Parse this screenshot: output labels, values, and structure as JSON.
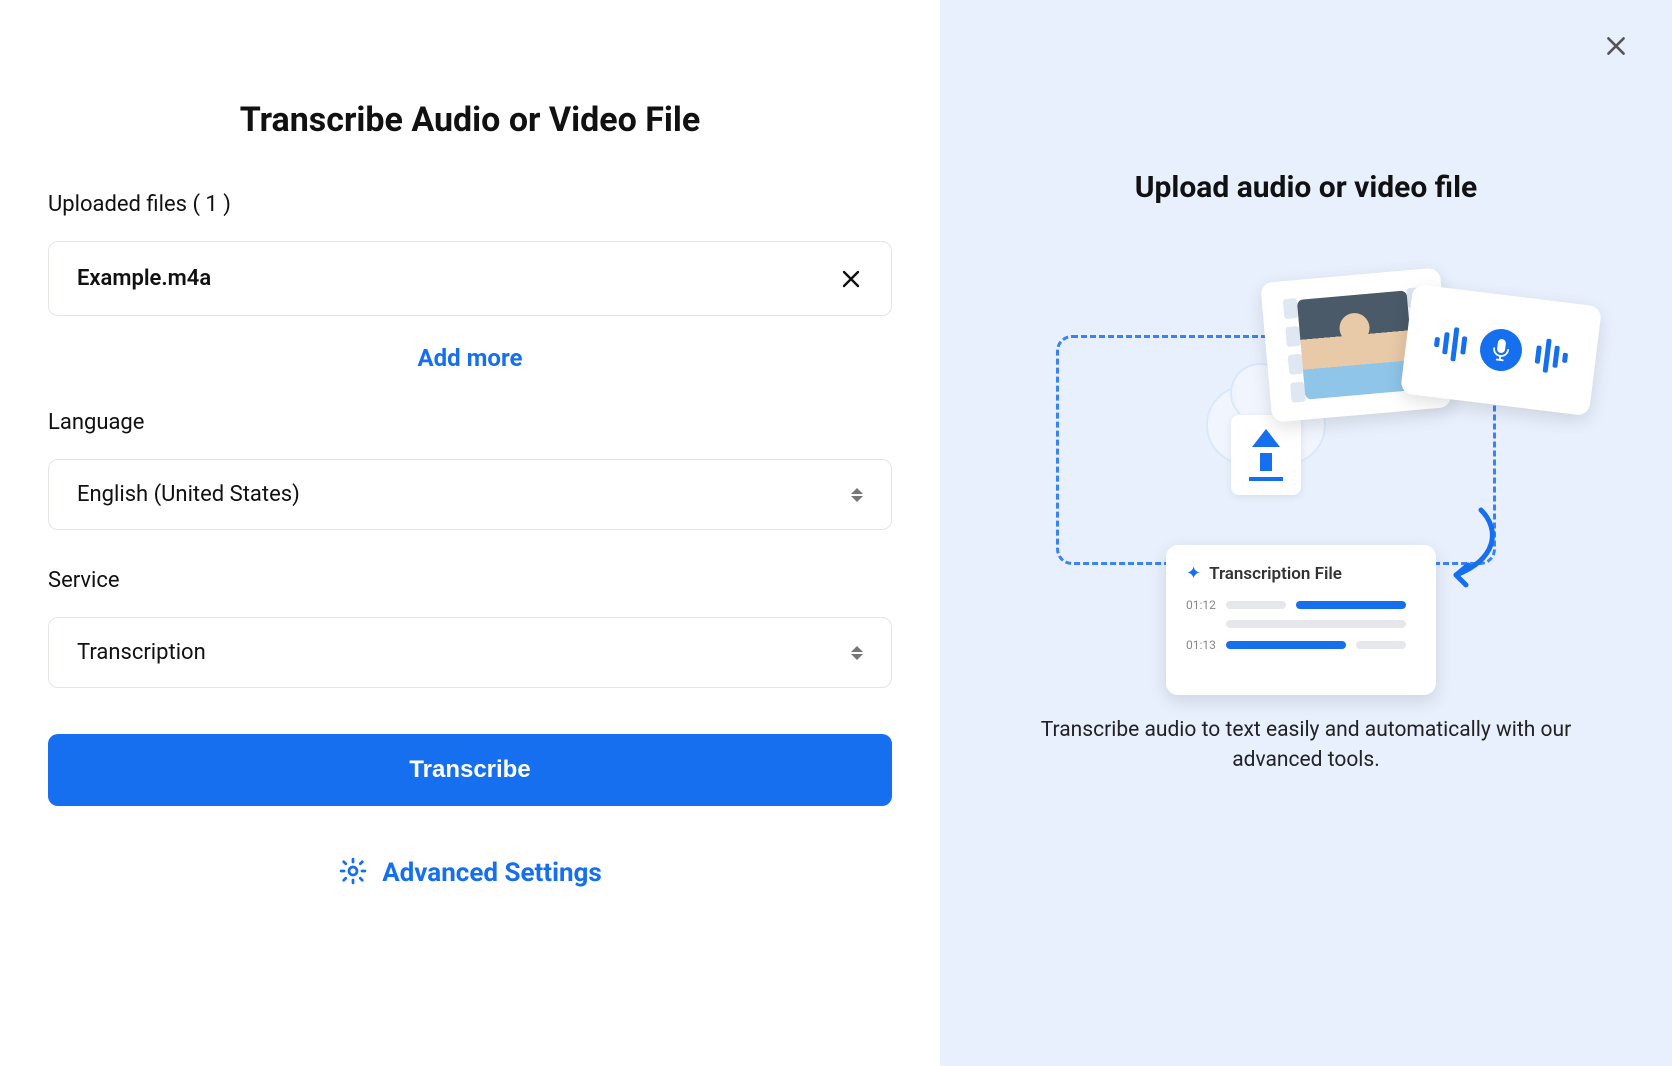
{
  "left": {
    "title": "Transcribe Audio or Video File",
    "uploaded_label": "Uploaded files ( 1 )",
    "files": [
      {
        "name": "Example.m4a"
      }
    ],
    "add_more": "Add more",
    "language_label": "Language",
    "language_value": "English (United States)",
    "service_label": "Service",
    "service_value": "Transcription",
    "transcribe_button": "Transcribe",
    "advanced_settings": "Advanced Settings"
  },
  "right": {
    "title": "Upload audio or video file",
    "caption": "Transcribe audio to text easily and automatically with our advanced tools.",
    "trans_card_title": "Transcription File",
    "timestamp1": "01:12",
    "timestamp2": "01:13"
  }
}
